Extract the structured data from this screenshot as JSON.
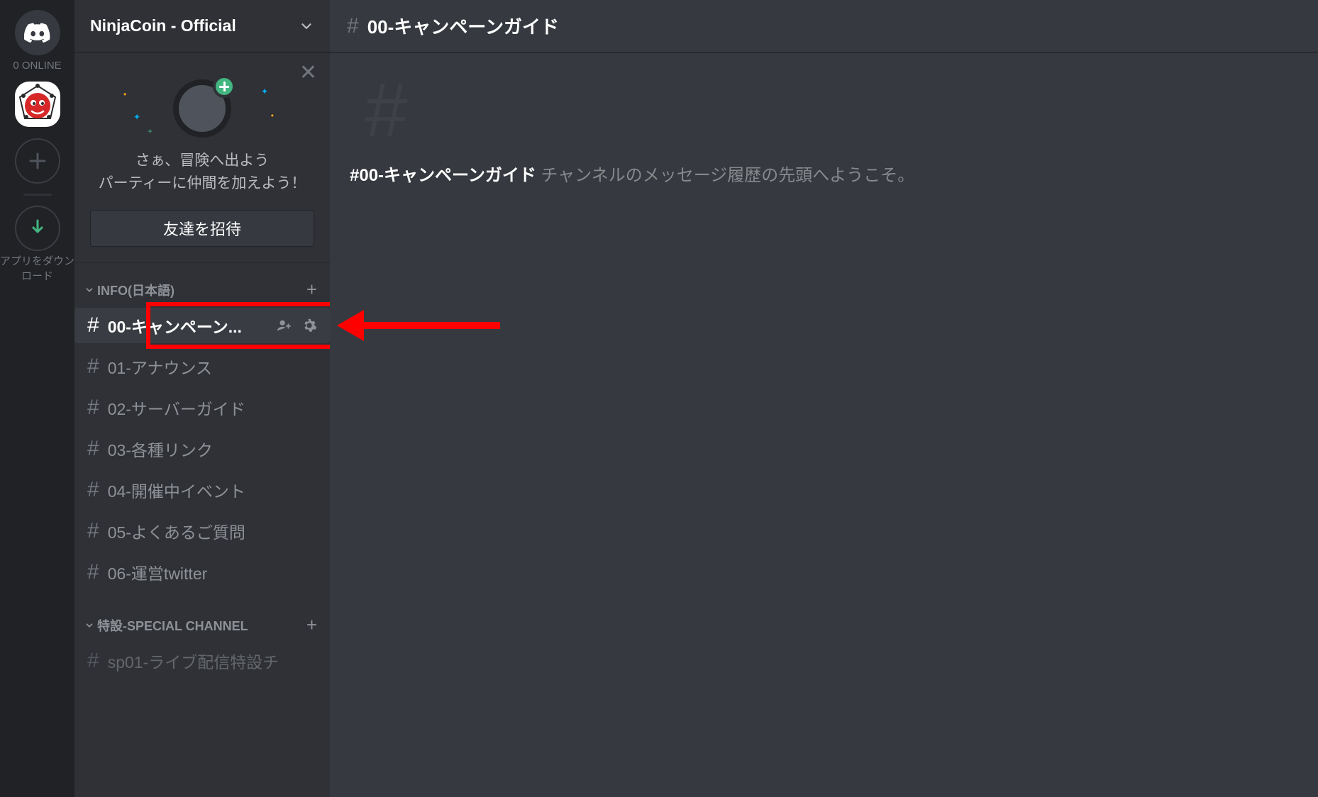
{
  "rail": {
    "online_label": "0 ONLINE",
    "download_label": "アプリをダウンロード"
  },
  "sidebar": {
    "server_name": "NinjaCoin - Official",
    "invite": {
      "line1": "さぁ、冒険へ出よう",
      "line2": "パーティーに仲間を加えよう！",
      "button": "友達を招待"
    },
    "categories": [
      {
        "name": "INFO(日本語)",
        "channels": [
          {
            "label": "00-キャンペーン...",
            "active": true,
            "full": "00-キャンペーンガイド"
          },
          {
            "label": "01-アナウンス",
            "active": false
          },
          {
            "label": "02-サーバーガイド",
            "active": false
          },
          {
            "label": "03-各種リンク",
            "active": false
          },
          {
            "label": "04-開催中イベント",
            "active": false
          },
          {
            "label": "05-よくあるご質問",
            "active": false
          },
          {
            "label": "06-運営twitter",
            "active": false
          }
        ]
      },
      {
        "name": "特設-SPECIAL CHANNEL",
        "channels": [
          {
            "label": "sp01-ライブ配信特設チ",
            "active": false
          }
        ]
      }
    ]
  },
  "main": {
    "header_channel": "00-キャンペーンガイド",
    "welcome_channel": "#00-キャンペーンガイド",
    "welcome_suffix": " チャンネルのメッセージ履歴の先頭へようこそ。"
  }
}
